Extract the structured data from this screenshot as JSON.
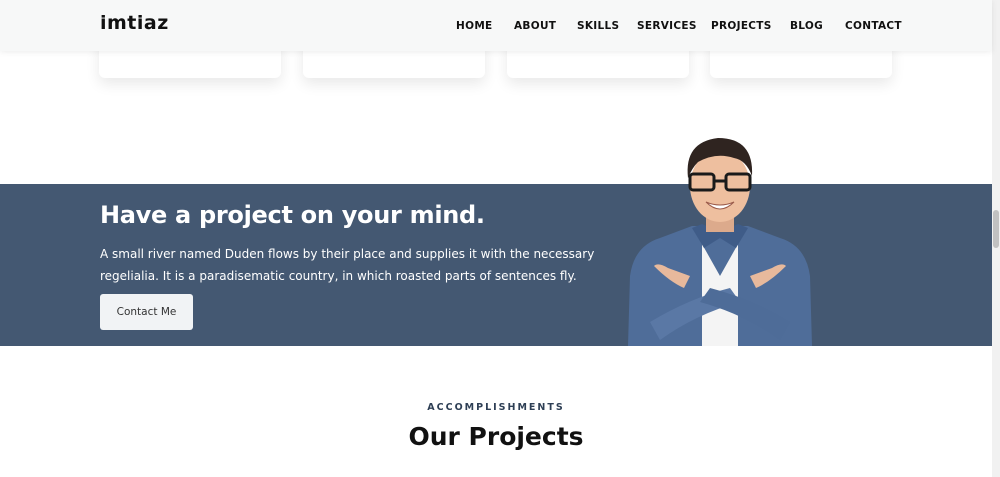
{
  "header": {
    "logo": "imtiaz",
    "nav": [
      "HOME",
      "ABOUT",
      "SKILLS",
      "SERVICES",
      "PROJECTS",
      "BLOG",
      "CONTACT"
    ]
  },
  "banner": {
    "title": "Have a project on your mind.",
    "text": "A small river named Duden flows by their place and supplies it with the necessary regelialia. It is a paradisematic country, in which roasted parts of sentences fly.",
    "button": "Contact Me"
  },
  "projects": {
    "eyebrow": "ACCOMPLISHMENTS",
    "title": "Our Projects"
  },
  "colors": {
    "banner_bg": "#445872",
    "header_bg": "#f7f8f8",
    "accent_text": "#2e3f55"
  }
}
